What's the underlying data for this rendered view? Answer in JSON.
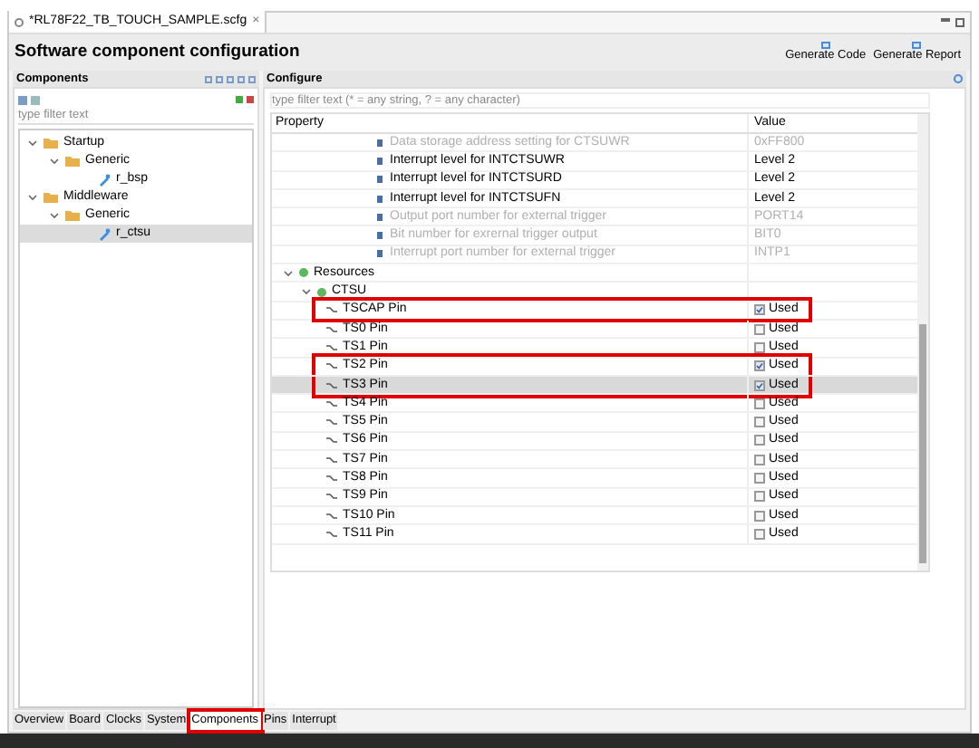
{
  "editor_tab": {
    "title": "*RL78F22_TB_TOUCH_SAMPLE.scfg",
    "close": "×"
  },
  "header": {
    "title": "Software component configuration",
    "actions": [
      "Generate Code",
      "Generate Report"
    ]
  },
  "components": {
    "title": "Components",
    "filter": {
      "placeholder": "type filter text"
    },
    "tree": [
      {
        "label": "Startup",
        "kind": "folder",
        "expanded": true,
        "selected": false,
        "children": [
          {
            "label": "Generic",
            "kind": "folder",
            "expanded": true,
            "selected": false,
            "children": [
              {
                "label": "r_bsp",
                "kind": "component",
                "selected": false
              }
            ]
          }
        ]
      },
      {
        "label": "Middleware",
        "kind": "folder",
        "expanded": true,
        "selected": false,
        "children": [
          {
            "label": "Generic",
            "kind": "folder",
            "expanded": true,
            "selected": false,
            "children": [
              {
                "label": "r_ctsu",
                "kind": "component",
                "selected": true
              }
            ]
          }
        ]
      }
    ]
  },
  "configure": {
    "title": "Configure",
    "filter": {
      "placeholder": "type filter text (* = any string, ? = any character)"
    },
    "columns": [
      "Property",
      "Value"
    ],
    "rows": [
      {
        "kind": "setting",
        "label": "Data storage address setting for CTSUWR",
        "value": "0xFF800",
        "disabled": true,
        "selected": false,
        "highlighted": false
      },
      {
        "kind": "setting",
        "label": "Interrupt level for INTCTSUWR",
        "value": "Level 2",
        "disabled": false,
        "selected": false,
        "highlighted": false
      },
      {
        "kind": "setting",
        "label": "Interrupt level for INTCTSURD",
        "value": "Level 2",
        "disabled": false,
        "selected": false,
        "highlighted": false
      },
      {
        "kind": "setting",
        "label": "Interrupt level for INTCTSUFN",
        "value": "Level 2",
        "disabled": false,
        "selected": false,
        "highlighted": false
      },
      {
        "kind": "setting",
        "label": "Output port number for external trigger",
        "value": "PORT14",
        "disabled": true,
        "selected": false,
        "highlighted": false
      },
      {
        "kind": "setting",
        "label": "Bit number for exrernal trigger output",
        "value": "BIT0",
        "disabled": true,
        "selected": false,
        "highlighted": false
      },
      {
        "kind": "setting",
        "label": "Interrupt port number for external trigger",
        "value": "INTP1",
        "disabled": true,
        "selected": false,
        "highlighted": false
      },
      {
        "kind": "group",
        "label": "Resources",
        "selected": false,
        "highlighted": false
      },
      {
        "kind": "subgroup",
        "label": "CTSU",
        "selected": false,
        "highlighted": false
      },
      {
        "kind": "pin",
        "label": "TSCAP Pin",
        "value": "Used",
        "checked": true,
        "selected": false,
        "highlighted": true
      },
      {
        "kind": "pin",
        "label": "TS0 Pin",
        "value": "Used",
        "checked": false,
        "selected": false,
        "highlighted": false
      },
      {
        "kind": "pin",
        "label": "TS1 Pin",
        "value": "Used",
        "checked": false,
        "selected": false,
        "highlighted": false
      },
      {
        "kind": "pin",
        "label": "TS2 Pin",
        "value": "Used",
        "checked": true,
        "selected": false,
        "highlighted": true
      },
      {
        "kind": "pin",
        "label": "TS3 Pin",
        "value": "Used",
        "checked": true,
        "selected": true,
        "highlighted": true
      },
      {
        "kind": "pin",
        "label": "TS4 Pin",
        "value": "Used",
        "checked": false,
        "selected": false,
        "highlighted": false
      },
      {
        "kind": "pin",
        "label": "TS5 Pin",
        "value": "Used",
        "checked": false,
        "selected": false,
        "highlighted": false
      },
      {
        "kind": "pin",
        "label": "TS6 Pin",
        "value": "Used",
        "checked": false,
        "selected": false,
        "highlighted": false
      },
      {
        "kind": "pin",
        "label": "TS7 Pin",
        "value": "Used",
        "checked": false,
        "selected": false,
        "highlighted": false
      },
      {
        "kind": "pin",
        "label": "TS8 Pin",
        "value": "Used",
        "checked": false,
        "selected": false,
        "highlighted": false
      },
      {
        "kind": "pin",
        "label": "TS9 Pin",
        "value": "Used",
        "checked": false,
        "selected": false,
        "highlighted": false
      },
      {
        "kind": "pin",
        "label": "TS10 Pin",
        "value": "Used",
        "checked": false,
        "selected": false,
        "highlighted": false
      },
      {
        "kind": "pin",
        "label": "TS11 Pin",
        "value": "Used",
        "checked": false,
        "selected": false,
        "highlighted": false
      }
    ]
  },
  "bottom_tabs": [
    {
      "label": "Overview",
      "selected": false,
      "highlighted": false
    },
    {
      "label": "Board",
      "selected": false,
      "highlighted": false
    },
    {
      "label": "Clocks",
      "selected": false,
      "highlighted": false
    },
    {
      "label": "System",
      "selected": false,
      "highlighted": false
    },
    {
      "label": "Components",
      "selected": true,
      "highlighted": true
    },
    {
      "label": "Pins",
      "selected": false,
      "highlighted": false
    },
    {
      "label": "Interrupt",
      "selected": false,
      "highlighted": false
    }
  ]
}
